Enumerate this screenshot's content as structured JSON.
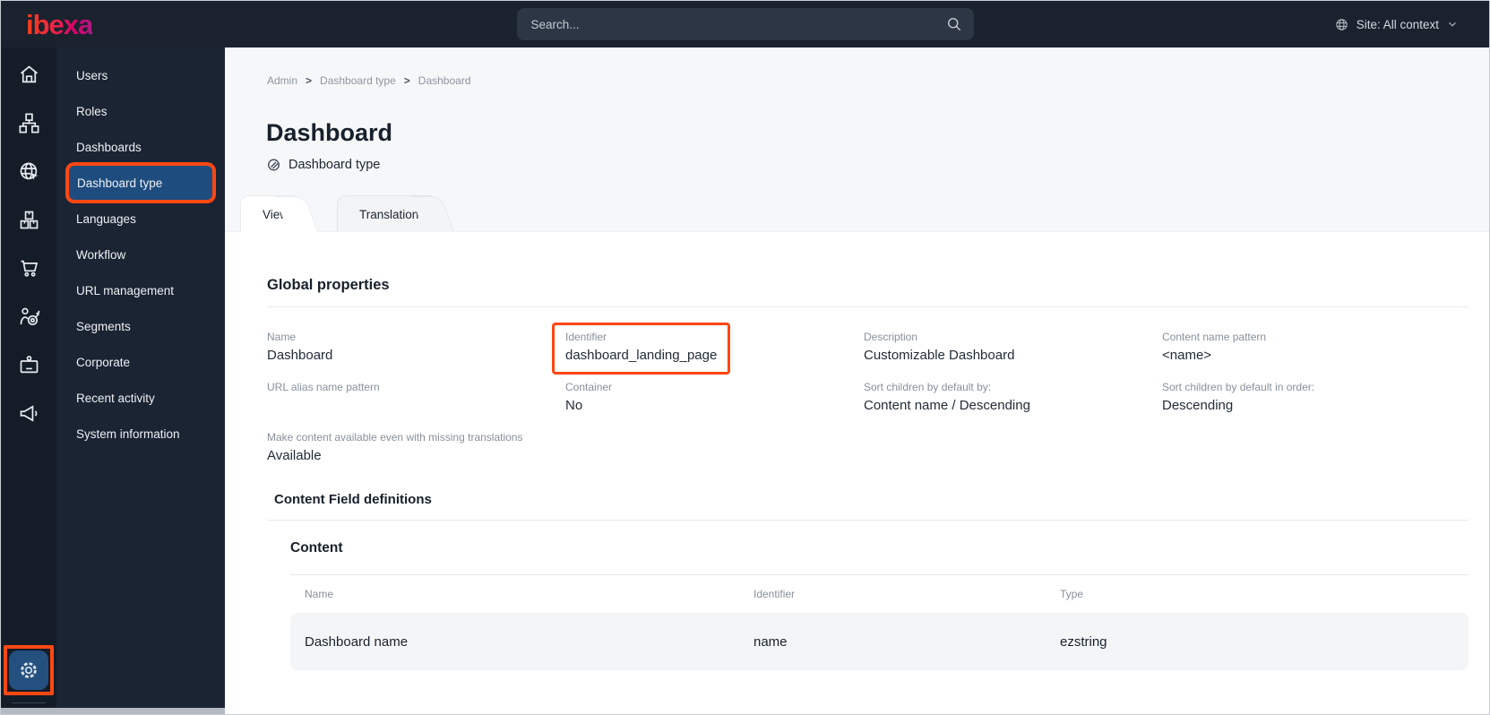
{
  "topbar": {
    "logo_text": "ibexa",
    "search_placeholder": "Search...",
    "site_context": "Site: All context"
  },
  "icons": {
    "rail": [
      "home-icon",
      "content-tree-icon",
      "site-globe-icon",
      "product-boxes-icon",
      "cart-icon",
      "personalization-target-icon",
      "corporate-badge-icon",
      "megaphone-icon",
      "settings-gear-icon"
    ],
    "topbar": [
      "search-icon",
      "globe-icon",
      "chevron-down-icon"
    ],
    "page": [
      "content-type-icon"
    ]
  },
  "sidebar": {
    "items": [
      {
        "label": "Users"
      },
      {
        "label": "Roles"
      },
      {
        "label": "Dashboards"
      },
      {
        "label": "Dashboard type",
        "selected": true,
        "annotated": true
      },
      {
        "label": "Languages"
      },
      {
        "label": "Workflow"
      },
      {
        "label": "URL management"
      },
      {
        "label": "Segments"
      },
      {
        "label": "Corporate"
      },
      {
        "label": "Recent activity"
      },
      {
        "label": "System information"
      }
    ]
  },
  "breadcrumb": {
    "items": [
      "Admin",
      "Dashboard type",
      "Dashboard"
    ],
    "separator": ">"
  },
  "page": {
    "title": "Dashboard",
    "subtitle": "Dashboard type"
  },
  "tabs": [
    {
      "label": "View",
      "active": true
    },
    {
      "label": "Translations",
      "active": false
    }
  ],
  "sections": {
    "global_properties": {
      "heading": "Global properties",
      "fields": [
        {
          "label": "Name",
          "value": "Dashboard"
        },
        {
          "label": "Identifier",
          "value": "dashboard_landing_page",
          "annotated": true
        },
        {
          "label": "Description",
          "value": "Customizable Dashboard"
        },
        {
          "label": "Content name pattern",
          "value": "<name>"
        },
        {
          "label": "URL alias name pattern",
          "value": ""
        },
        {
          "label": "Container",
          "value": "No"
        },
        {
          "label": "Sort children by default by:",
          "value": "Content name / Descending"
        },
        {
          "label": "Sort children by default in order:",
          "value": "Descending"
        },
        {
          "label": "Make content available even with missing translations",
          "value": "Available"
        }
      ]
    },
    "field_definitions": {
      "heading": "Content Field definitions",
      "group": "Content",
      "table": {
        "headers": [
          "Name",
          "Identifier",
          "Type"
        ],
        "rows": [
          [
            "Dashboard name",
            "name",
            "ezstring"
          ]
        ]
      }
    }
  },
  "colors": {
    "annotation_orange": "#ff4713",
    "selected_item_blue": "#1e4c7e",
    "topbar_bg": "#1a222e",
    "rail_bg": "#141c27",
    "menu_bg": "#1b2433",
    "logo_gradient_start": "#ff3b1a",
    "logo_gradient_end": "#a81d86"
  }
}
